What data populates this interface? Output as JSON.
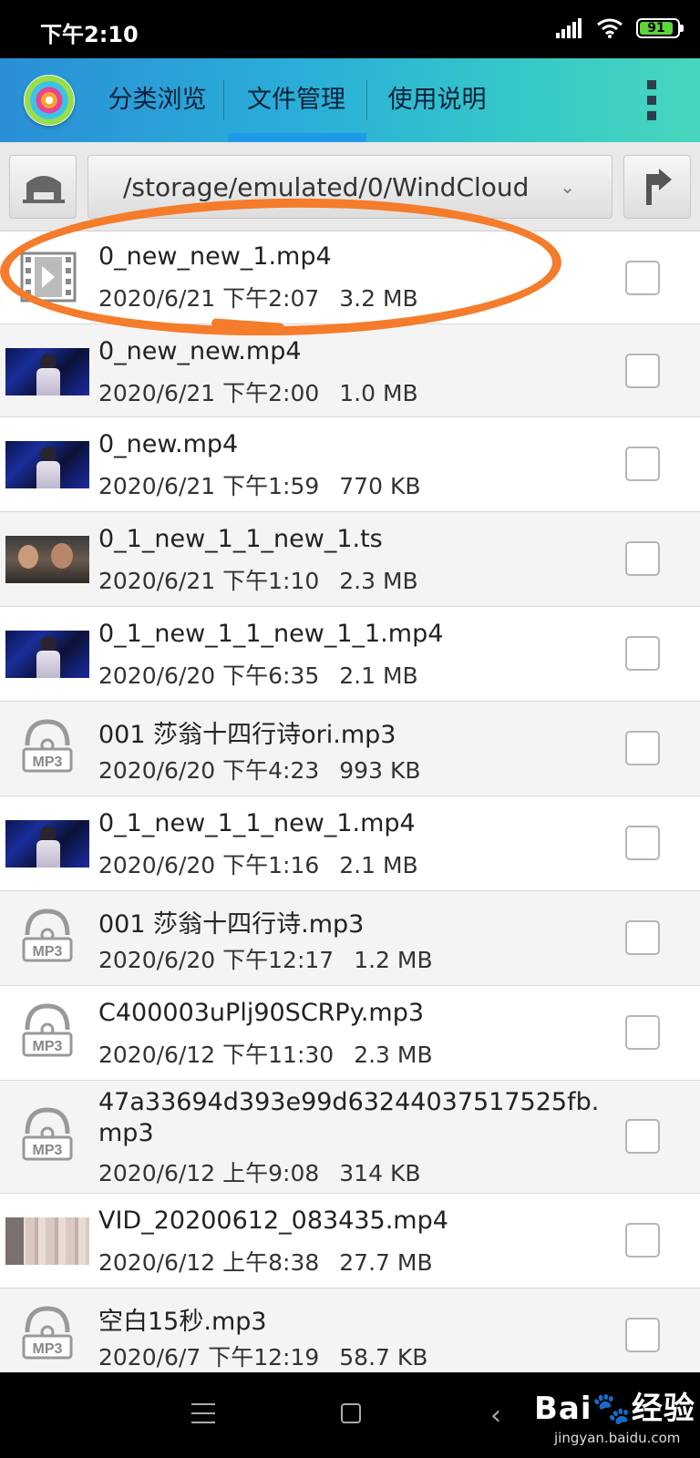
{
  "status_bar": {
    "time": "下午2:10",
    "battery_level": "91"
  },
  "app_bar": {
    "tabs": [
      {
        "label": "分类浏览"
      },
      {
        "label": "文件管理"
      },
      {
        "label": "使用说明"
      }
    ],
    "active_tab": "文件管理"
  },
  "path_bar": {
    "path": "/storage/emulated/0/WindCloud"
  },
  "files": [
    {
      "name": "0_new_new_1.mp4",
      "date": "2020/6/21 下午2:07",
      "size": "3.2 MB",
      "icon": "video-file-icon"
    },
    {
      "name": "0_new_new.mp4",
      "date": "2020/6/21 下午2:00",
      "size": "1.0 MB",
      "icon": "stage-thumbnail"
    },
    {
      "name": "0_new.mp4",
      "date": "2020/6/21 下午1:59",
      "size": "770 KB",
      "icon": "stage-thumbnail"
    },
    {
      "name": "0_1_new_1_1_new_1.ts",
      "date": "2020/6/21 下午1:10",
      "size": "2.3 MB",
      "icon": "crowd-thumbnail"
    },
    {
      "name": "0_1_new_1_1_new_1_1.mp4",
      "date": "2020/6/20 下午6:35",
      "size": "2.1 MB",
      "icon": "stage-thumbnail"
    },
    {
      "name": "001 莎翁十四行诗ori.mp3",
      "date": "2020/6/20 下午4:23",
      "size": "993 KB",
      "icon": "mp3-icon"
    },
    {
      "name": "0_1_new_1_1_new_1.mp4",
      "date": "2020/6/20 下午1:16",
      "size": "2.1 MB",
      "icon": "stage-thumbnail"
    },
    {
      "name": "001 莎翁十四行诗.mp3",
      "date": "2020/6/20 下午12:17",
      "size": "1.2 MB",
      "icon": "mp3-icon"
    },
    {
      "name": "C400003uPlj90SCRPy.mp3",
      "date": "2020/6/12 下午11:30",
      "size": "2.3 MB",
      "icon": "mp3-icon"
    },
    {
      "name_line1": "47a33694d393e99d63244037517525fb.",
      "name_line2": "mp3",
      "date": "2020/6/12 上午9:08",
      "size": "314 KB",
      "icon": "mp3-icon"
    },
    {
      "name": "VID_20200612_083435.mp4",
      "date": "2020/6/12 上午8:38",
      "size": "27.7 MB",
      "icon": "curtain-thumbnail"
    },
    {
      "name": "空白15秒.mp3",
      "date": "2020/6/7 下午12:19",
      "size": "58.7 KB",
      "icon": "mp3-icon"
    }
  ],
  "watermark": {
    "brand": "Bai🐾经验",
    "url": "jingyan.baidu.com"
  },
  "colors": {
    "highlight": "#f47c2a",
    "tab_indicator": "#1e9be8",
    "app_bar_start": "#2a8fd6",
    "app_bar_end": "#47d6bd"
  }
}
